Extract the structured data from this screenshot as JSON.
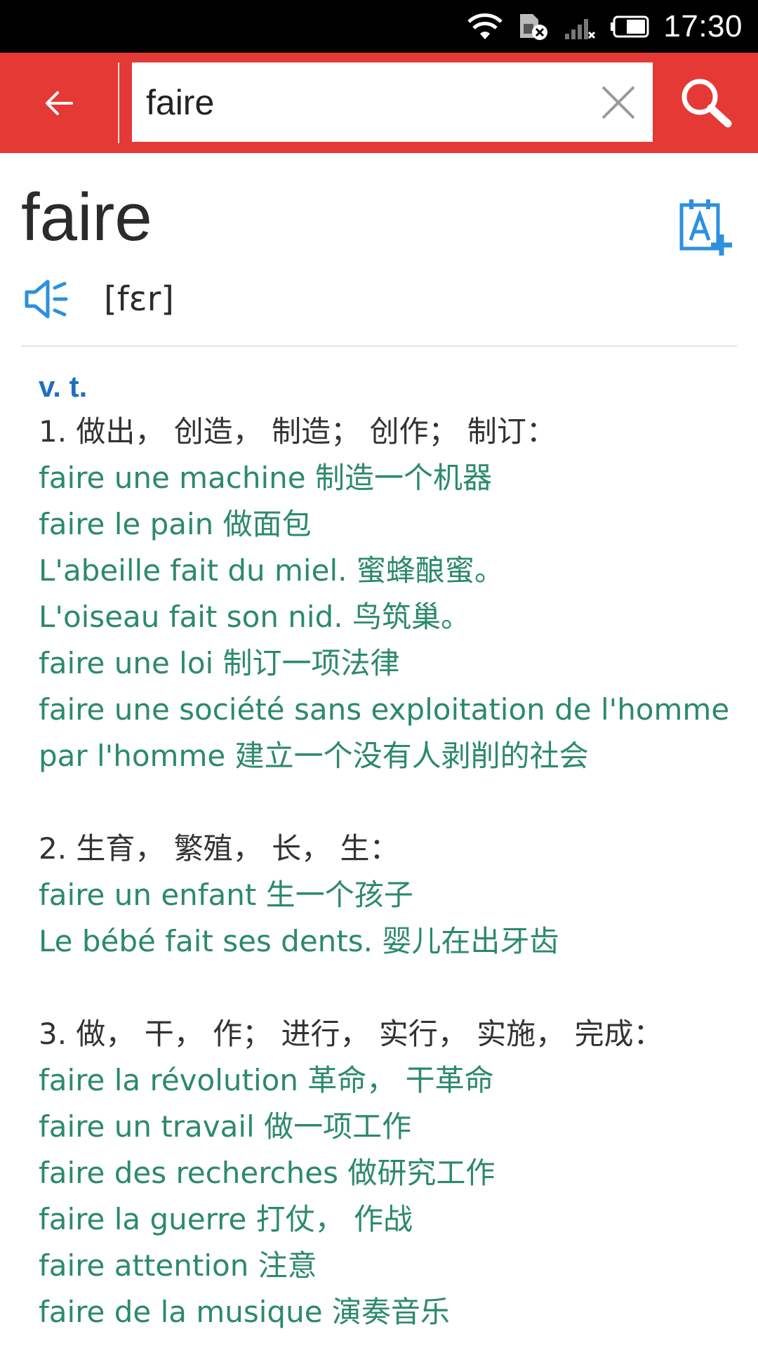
{
  "status_bar": {
    "time": "17:30",
    "icons": [
      "wifi-icon",
      "sim-blocked-icon",
      "signal-none-icon",
      "battery-icon"
    ]
  },
  "toolbar": {
    "back_icon": "arrow-left-icon",
    "search_value": "faire",
    "clear_icon": "close-icon",
    "search_icon": "search-icon",
    "accent_color": "#e53935"
  },
  "entry": {
    "headword": "faire",
    "phonetic": "[fɛr]",
    "speaker_icon": "speaker-icon",
    "wordbook_icon": "add-to-wordbook-icon",
    "part_of_speech": "v. t.",
    "senses": [
      {
        "meaning": "1. 做出， 创造， 制造； 创作； 制订：",
        "examples": [
          "faire une machine 制造一个机器",
          "faire le pain 做面包",
          "L'abeille fait du miel. 蜜蜂酿蜜。",
          "L'oiseau fait son nid. 鸟筑巢。",
          "faire une loi 制订一项法律",
          "faire une société sans exploitation de l'homme",
          "par l'homme 建立一个没有人剥削的社会"
        ]
      },
      {
        "meaning": "2. 生育， 繁殖， 长， 生：",
        "examples": [
          "faire un enfant 生一个孩子",
          "Le bébé fait ses dents. 婴儿在出牙齿"
        ]
      },
      {
        "meaning": "3. 做， 干， 作； 进行， 实行， 实施， 完成：",
        "examples": [
          "faire la révolution 革命， 干革命",
          "faire un travail 做一项工作",
          "faire des recherches 做研究工作",
          "faire la guerre 打仗， 作战",
          "faire attention 注意",
          "faire de la musique 演奏音乐"
        ]
      }
    ]
  }
}
